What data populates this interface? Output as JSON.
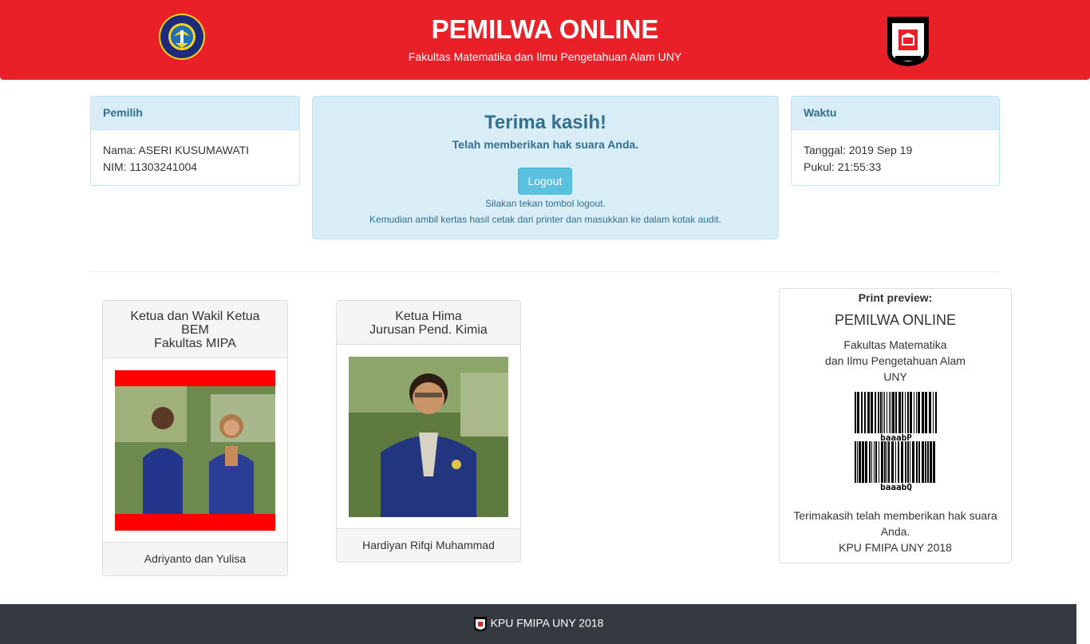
{
  "header": {
    "title": "PEMILWA ONLINE",
    "subtitle": "Fakultas Matematika dan Ilmu Pengetahuan Alam UNY",
    "left_logo": "uny-logo",
    "right_logo": "komisi-pemilihan-umum-fmipa-logo",
    "right_logo_text": "PEMILIHAN KOMISI UMUM FMIPA"
  },
  "pemilih": {
    "heading": "Pemilih",
    "name": "Nama: ASERI KUSUMAWATI",
    "nim": "NIM: 11303241004"
  },
  "message": {
    "title": "Terima kasih!",
    "subtitle": "Telah memberikan hak suara Anda.",
    "logout_label": "Logout",
    "note1": "Silakan tekan tombol logout.",
    "note2": "Kemudian ambil kertas hasil cetak dari printer dan masukkan ke dalam kotak audit."
  },
  "waktu": {
    "heading": "Waktu",
    "tanggal": "Tanggal: 2019 Sep 19",
    "pukul": "Pukul: 21:55:33"
  },
  "candidates": [
    {
      "heading_lines": [
        "Ketua dan Wakil Ketua",
        "BEM",
        "Fakultas MIPA"
      ],
      "name": "Adriyanto dan Yulisa",
      "photo": "candidate-pair-photo"
    },
    {
      "heading_lines": [
        "Ketua Hima",
        "Jurusan Pend. Kimia"
      ],
      "name": "Hardiyan Rifqi Muhammad",
      "photo": "candidate-photo"
    }
  ],
  "preview": {
    "label": "Print preview:",
    "title": "PEMILWA ONLINE",
    "sub_lines": [
      "Fakultas Matematika",
      "dan Ilmu Pengetahuan Alam",
      "UNY"
    ],
    "barcodes": [
      "baaabP",
      "baaabQ"
    ],
    "thanks_lines": [
      "Terimakasih telah memberikan hak suara",
      "Anda.",
      "KPU FMIPA UNY 2018"
    ]
  },
  "footer": {
    "text": "KPU FMIPA UNY 2018",
    "logo": "kpu-logo"
  },
  "colors": {
    "header_red": "#ea2029",
    "info_bg": "#d9edf7",
    "info_text": "#31708f",
    "button_info": "#5bc0de",
    "footer_dark": "#343a40"
  }
}
